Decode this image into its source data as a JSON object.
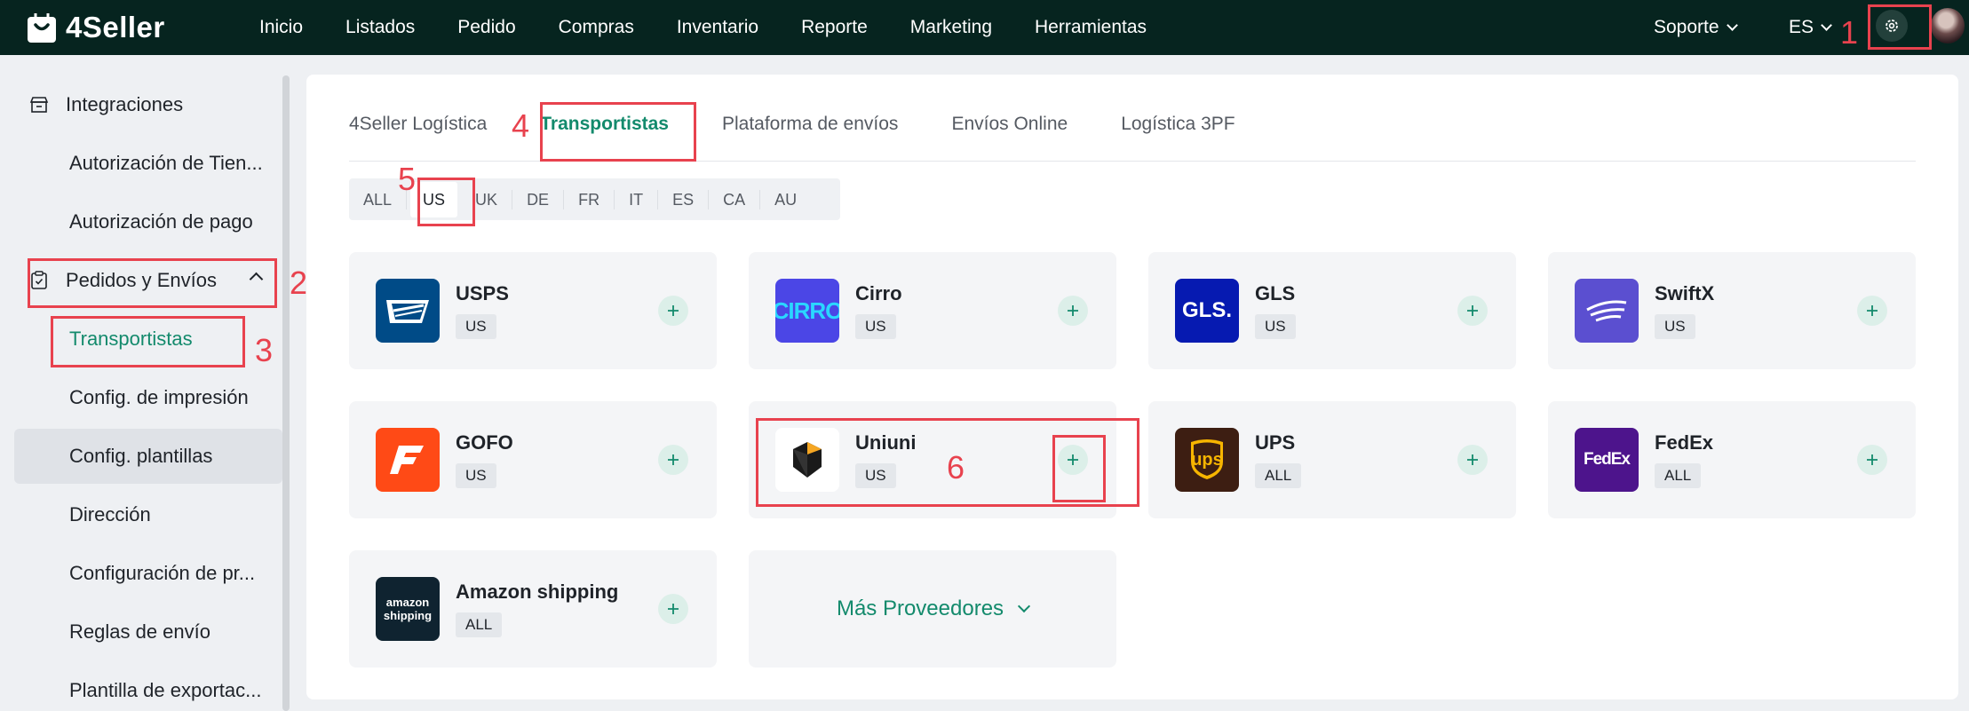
{
  "app": {
    "brand": "4Seller"
  },
  "nav": {
    "items": [
      "Inicio",
      "Listados",
      "Pedido",
      "Compras",
      "Inventario",
      "Reporte",
      "Marketing",
      "Herramientas"
    ]
  },
  "header": {
    "support": "Soporte",
    "language": "ES"
  },
  "sidebar": {
    "integrations": "Integraciones",
    "items_top": [
      "Autorización de Tien...",
      "Autorización de pago"
    ],
    "orders_group": "Pedidos y Envíos",
    "items_orders": [
      "Transportistas",
      "Config. de impresión",
      "Config. plantillas",
      "Dirección",
      "Configuración de pr...",
      "Reglas de envío",
      "Plantilla de exportac..."
    ]
  },
  "tabs": [
    "4Seller Logística",
    "Transportistas",
    "Plataforma de envíos",
    "Envíos Online",
    "Logística 3PF"
  ],
  "regions": [
    "ALL",
    "US",
    "UK",
    "DE",
    "FR",
    "IT",
    "ES",
    "CA",
    "AU"
  ],
  "carriers": [
    {
      "name": "USPS",
      "region": "US",
      "logo": "usps-icon",
      "color": "#004b87"
    },
    {
      "name": "Cirro",
      "region": "US",
      "logo": "cirro-icon",
      "color": "#4b46e6",
      "logo_text": "CIRRO"
    },
    {
      "name": "GLS",
      "region": "US",
      "logo": "gls-icon",
      "color": "#061ab1",
      "logo_text": "GLS."
    },
    {
      "name": "SwiftX",
      "region": "US",
      "logo": "swiftx-icon",
      "color": "#5b4fd0"
    },
    {
      "name": "GOFO",
      "region": "US",
      "logo": "gofo-icon",
      "color": "#ff4a16"
    },
    {
      "name": "Uniuni",
      "region": "US",
      "logo": "uniuni-icon",
      "color": "#ffffff"
    },
    {
      "name": "UPS",
      "region": "ALL",
      "logo": "ups-icon",
      "color": "#3d1e12",
      "logo_text": "ups"
    },
    {
      "name": "FedEx",
      "region": "ALL",
      "logo": "fedex-icon",
      "color": "#4d148c",
      "logo_text": "FedEx"
    },
    {
      "name": "Amazon shipping",
      "region": "ALL",
      "logo": "amazon-shipping-icon",
      "color": "#0f2330",
      "logo_text": "amazon shipping"
    }
  ],
  "more_providers": "Más Proveedores",
  "annotations": [
    "1",
    "2",
    "3",
    "4",
    "5",
    "6"
  ],
  "colors": {
    "accent": "#138a6c",
    "topbar": "#06241f",
    "annotation": "#e8424e"
  }
}
